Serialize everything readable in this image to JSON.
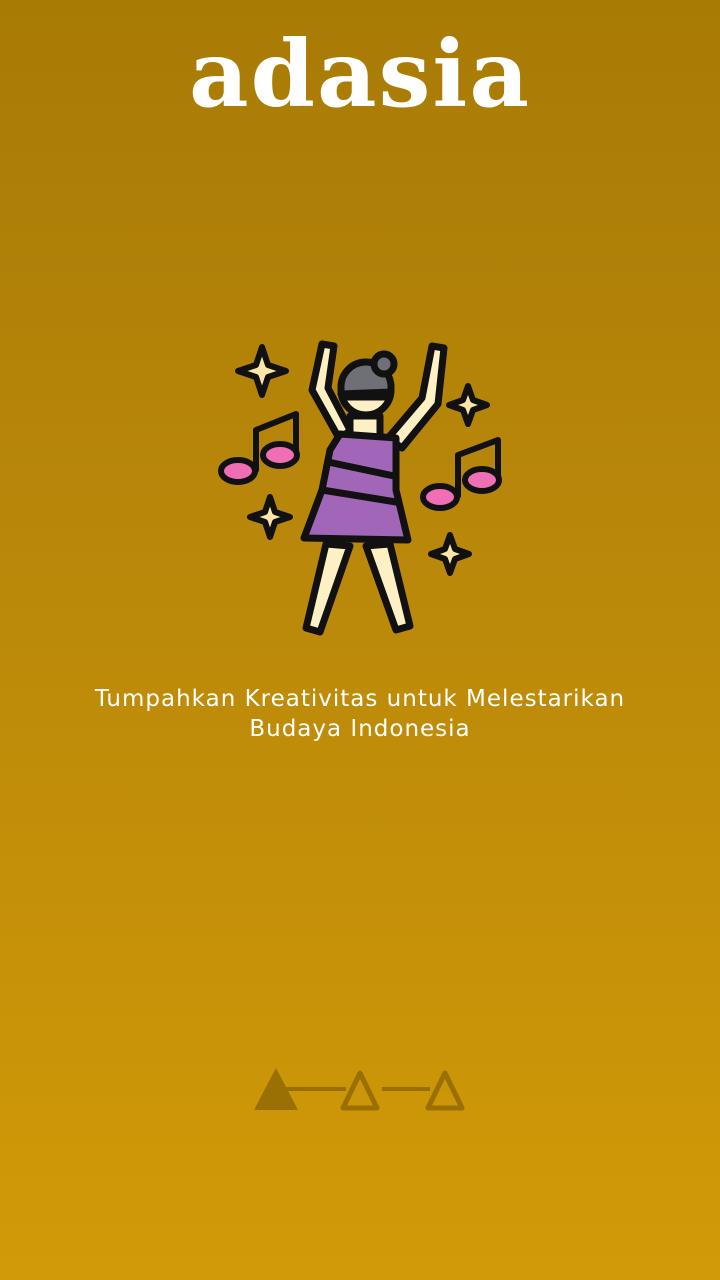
{
  "app": {
    "logo_text": "adasia"
  },
  "onboarding": {
    "tagline_line1": "Tumpahkan Kreativitas untuk Melestarikan",
    "tagline_line2": "Budaya Indonesia",
    "illustration_icon": "dancing-woman-icon",
    "current_page": 1,
    "total_pages": 3
  },
  "colors": {
    "background_top": "#a87b05",
    "background_bottom": "#d19a08",
    "indicator": "#9a6f03",
    "dress": "#a266b8",
    "skin": "#fdf0c4",
    "note_head": "#f06eb4"
  }
}
